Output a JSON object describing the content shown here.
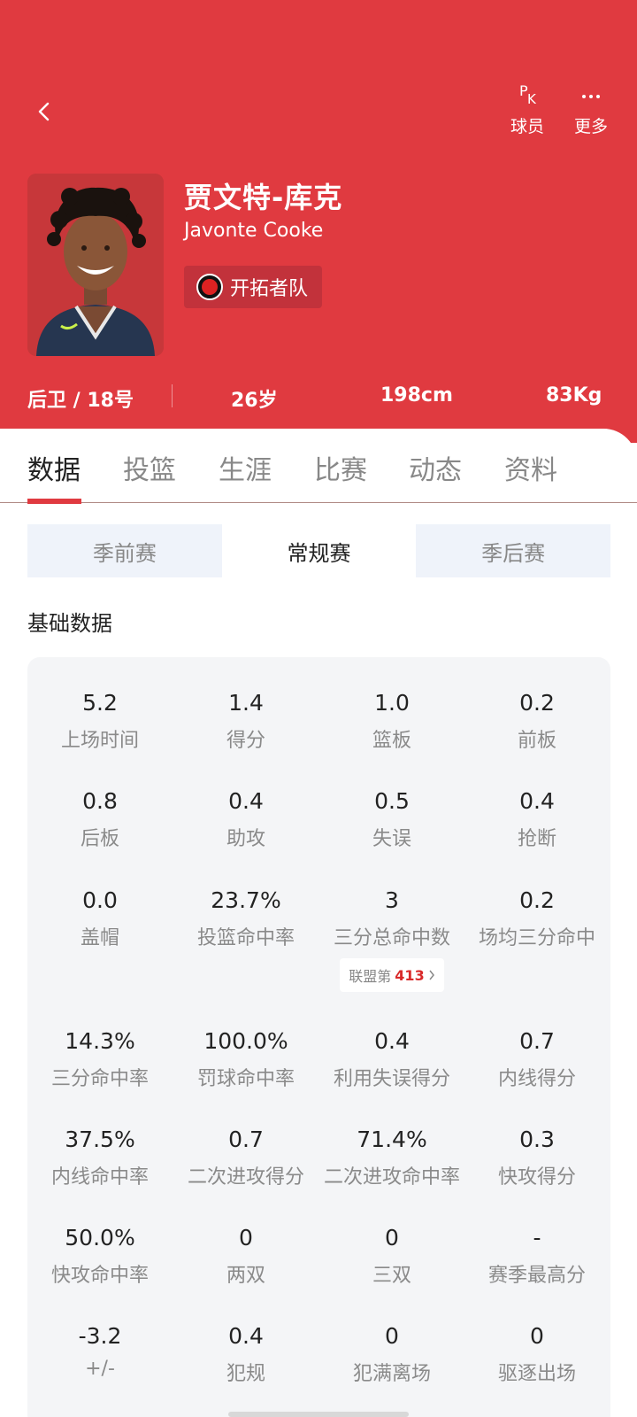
{
  "header": {
    "actions": [
      {
        "icon": "pk-icon",
        "label": "球员"
      },
      {
        "icon": "more-icon",
        "label": "更多"
      }
    ],
    "player": {
      "name_cn": "贾文特-库克",
      "name_en": "Javonte Cooke",
      "team": "开拓者队",
      "position_number": "后卫 / 18号",
      "age": "26岁",
      "height": "198cm",
      "weight": "83Kg"
    },
    "colors": {
      "primary": "#e03a40",
      "badge": "#c2323b"
    }
  },
  "tabs": [
    "数据",
    "投篮",
    "生涯",
    "比赛",
    "动态",
    "资料"
  ],
  "segments": [
    "季前赛",
    "常规赛",
    "季后赛"
  ],
  "section_title": "基础数据",
  "stats": [
    {
      "value": "5.2",
      "label": "上场时间"
    },
    {
      "value": "1.4",
      "label": "得分"
    },
    {
      "value": "1.0",
      "label": "篮板"
    },
    {
      "value": "0.2",
      "label": "前板"
    },
    {
      "value": "0.8",
      "label": "后板"
    },
    {
      "value": "0.4",
      "label": "助攻"
    },
    {
      "value": "0.5",
      "label": "失误"
    },
    {
      "value": "0.4",
      "label": "抢断"
    },
    {
      "value": "0.0",
      "label": "盖帽"
    },
    {
      "value": "23.7%",
      "label": "投篮命中率"
    },
    {
      "value": "3",
      "label": "三分总命中数"
    },
    {
      "value": "0.2",
      "label": "场均三分命中"
    },
    {
      "value": "14.3%",
      "label": "三分命中率"
    },
    {
      "value": "100.0%",
      "label": "罚球命中率"
    },
    {
      "value": "0.4",
      "label": "利用失误得分"
    },
    {
      "value": "0.7",
      "label": "内线得分"
    },
    {
      "value": "37.5%",
      "label": "内线命中率"
    },
    {
      "value": "0.7",
      "label": "二次进攻得分"
    },
    {
      "value": "71.4%",
      "label": "二次进攻命中率"
    },
    {
      "value": "0.3",
      "label": "快攻得分"
    },
    {
      "value": "50.0%",
      "label": "快攻命中率"
    },
    {
      "value": "0",
      "label": "两双"
    },
    {
      "value": "0",
      "label": "三双"
    },
    {
      "value": "-",
      "label": "赛季最高分"
    },
    {
      "value": "-3.2",
      "label": "+/-"
    },
    {
      "value": "0.4",
      "label": "犯规"
    },
    {
      "value": "0",
      "label": "犯满离场"
    },
    {
      "value": "0",
      "label": "驱逐出场"
    }
  ],
  "rank_chip": {
    "prefix": "联盟第",
    "rank": "413"
  }
}
